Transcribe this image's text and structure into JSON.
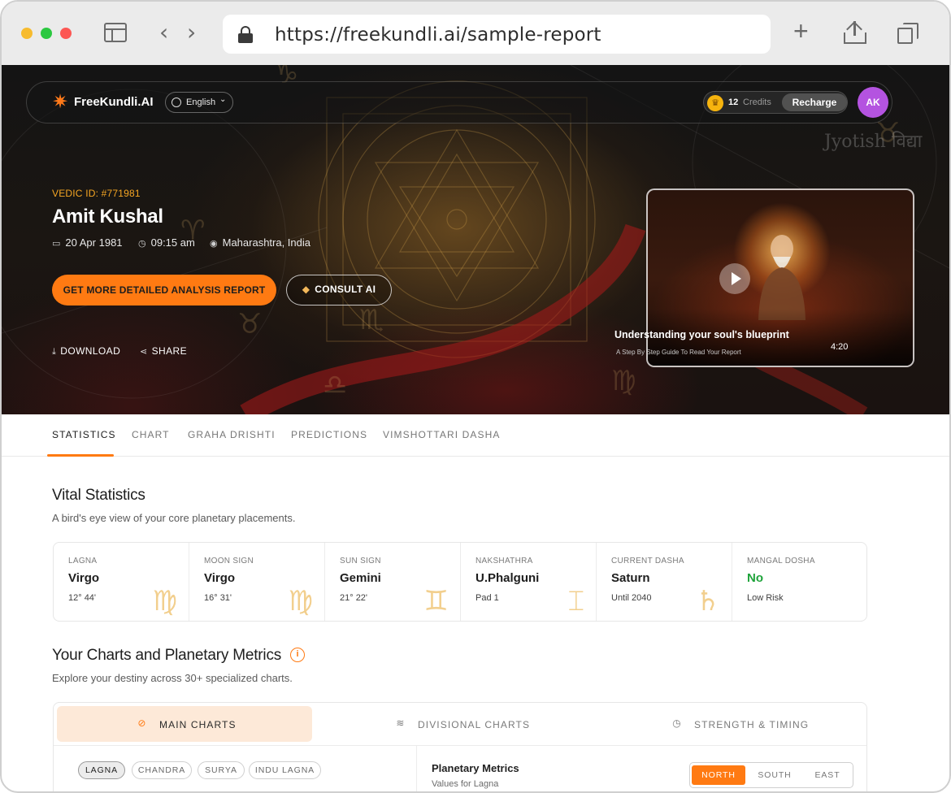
{
  "browser": {
    "url": "https://freekundli.ai/sample-report"
  },
  "nav": {
    "brand": "FreeKundli.AI",
    "language": "English",
    "credits_count": "12",
    "credits_label": "Credits",
    "recharge_label": "Recharge",
    "avatar_initials": "AK"
  },
  "profile": {
    "vedic_id": "VEDIC ID: #771981",
    "name": "Amit Kushal",
    "date": "20 Apr 1981",
    "time": "09:15 am",
    "place": "Maharashtra, India"
  },
  "actions": {
    "primary_cta": "GET MORE DETAILED ANALYSIS REPORT",
    "consult": "CONSULT AI",
    "download": "DOWNLOAD",
    "share": "SHARE"
  },
  "video": {
    "title": "Understanding your soul's blueprint",
    "subtitle": "A Step By Step Guide To Read Your Report",
    "duration": "4:20",
    "watermark": "Jyotish विद्या"
  },
  "tabs": [
    "STATISTICS",
    "CHART",
    "GRAHA DRISHTI",
    "PREDICTIONS",
    "VIMSHOTTARI DASHA"
  ],
  "active_tab": "STATISTICS",
  "vital": {
    "title": "Vital Statistics",
    "subtitle": "A bird's eye view of your core planetary placements.",
    "items": [
      {
        "label": "LAGNA",
        "value": "Virgo",
        "sub": "12° 44'",
        "icon": "virgo-icon",
        "glyph": "♍"
      },
      {
        "label": "MOON SIGN",
        "value": "Virgo",
        "sub": "16° 31'",
        "icon": "virgo-icon",
        "glyph": "♍"
      },
      {
        "label": "SUN SIGN",
        "value": "Gemini",
        "sub": "21° 22'",
        "icon": "gemini-icon",
        "glyph": "♊"
      },
      {
        "label": "NAKSHATHRA",
        "value": "U.Phalguni",
        "sub": "Pad 1",
        "icon": "nakshatra-icon",
        "glyph": "⌶"
      },
      {
        "label": "CURRENT DASHA",
        "value": "Saturn",
        "sub": "Until 2040",
        "icon": "saturn-icon",
        "glyph": "♄"
      },
      {
        "label": "MANGAL DOSHA",
        "value": "No",
        "sub": "Low Risk",
        "icon": "",
        "glyph": "",
        "value_color": "#1ea33a"
      }
    ]
  },
  "charts": {
    "title": "Your Charts and Planetary Metrics",
    "subtitle": "Explore your destiny across 30+ specialized charts.",
    "panel_tabs": [
      {
        "label": "MAIN CHARTS",
        "icon": "compass-icon"
      },
      {
        "label": "DIVISIONAL CHARTS",
        "icon": "layers-icon"
      },
      {
        "label": "STRENGTH & TIMING",
        "icon": "clock-icon"
      }
    ],
    "chips": [
      "LAGNA",
      "CHANDRA",
      "SURYA",
      "INDU LAGNA"
    ],
    "metrics_title": "Planetary Metrics",
    "metrics_sub": "Values for Lagna",
    "styles": [
      "NORTH",
      "SOUTH",
      "EAST"
    ]
  },
  "colors": {
    "accent": "#ff7a12",
    "vedic_id": "#f5a623",
    "avatar": "#b453e0",
    "success": "#1ea33a"
  }
}
